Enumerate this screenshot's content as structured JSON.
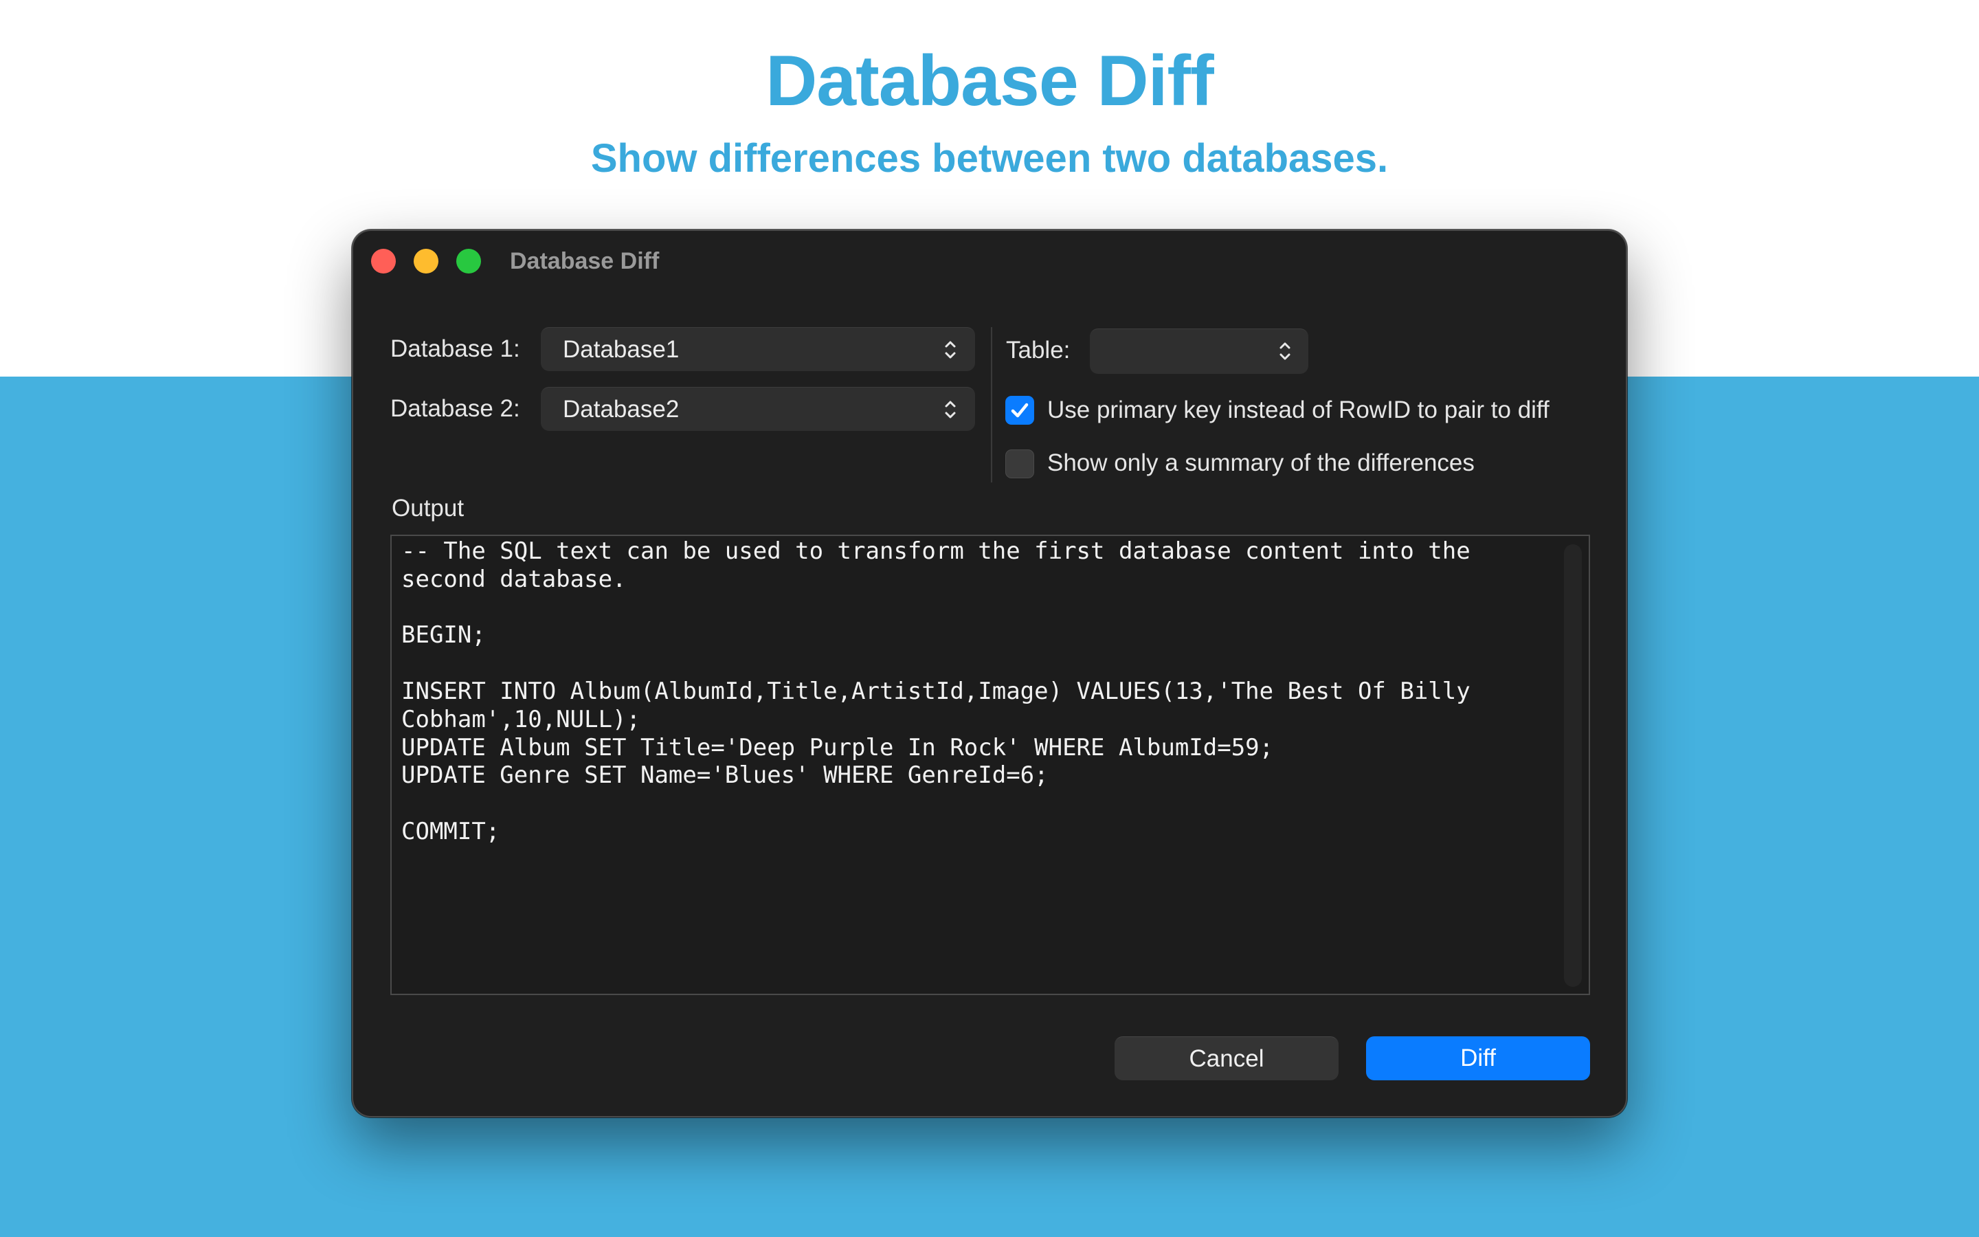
{
  "hero": {
    "title": "Database Diff",
    "subtitle": "Show differences between two databases."
  },
  "colors": {
    "brand_blue": "#45b1df",
    "hero_text": "#3aa9dc",
    "window_bg": "#1f1f1f",
    "accent": "#0a7cff"
  },
  "window": {
    "title": "Database Diff"
  },
  "form": {
    "db1_label": "Database 1:",
    "db1_value": "Database1",
    "db2_label": "Database 2:",
    "db2_value": "Database2",
    "table_label": "Table:",
    "table_value": "",
    "option_primary_key": {
      "label": "Use primary key instead of RowID to pair to diff",
      "checked": true
    },
    "option_summary": {
      "label": "Show only a summary of the differences",
      "checked": false
    }
  },
  "output": {
    "label": "Output",
    "text": "-- The SQL text can be used to transform the first database content into the second database.\n\nBEGIN;\n\nINSERT INTO Album(AlbumId,Title,ArtistId,Image) VALUES(13,'The Best Of Billy Cobham',10,NULL);\nUPDATE Album SET Title='Deep Purple In Rock' WHERE AlbumId=59;\nUPDATE Genre SET Name='Blues' WHERE GenreId=6;\n\nCOMMIT;"
  },
  "buttons": {
    "cancel": "Cancel",
    "diff": "Diff"
  },
  "icons": {
    "popup_indicator": "chevron-up-down-icon",
    "checkmark": "checkmark-icon"
  }
}
